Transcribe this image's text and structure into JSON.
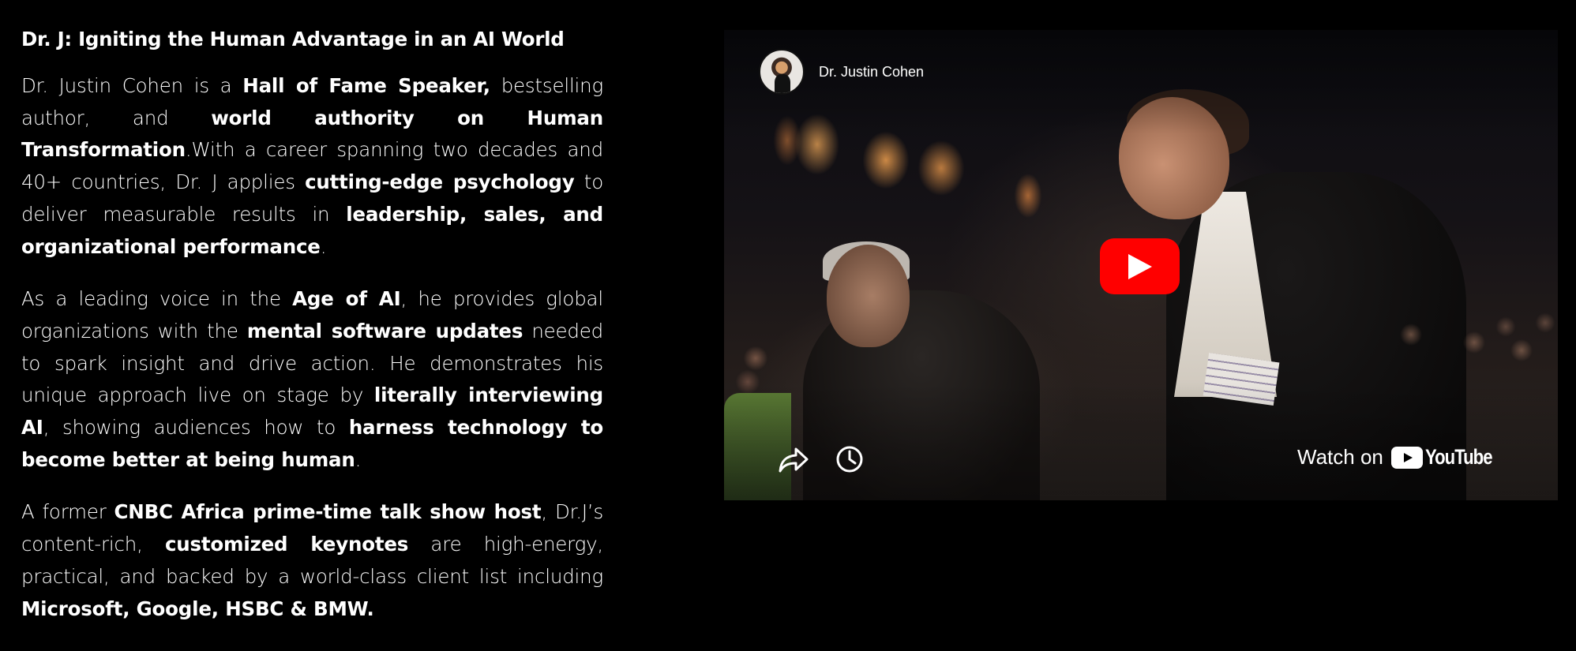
{
  "heading": "Dr. J: Igniting the Human Advantage in an AI World",
  "paragraph1": {
    "p1": "Dr. Justin Cohen is a ",
    "b1": "Hall of Fame Speaker,",
    "p2": " bestselling author, and ",
    "b2": "world authority on Human Transformation",
    "p3": ".With a career spanning two decades and 40+ countries, Dr. J applies ",
    "b3": "cutting-edge psychology",
    "p4": " to deliver measurable results in ",
    "b4": "leadership, sales, and organizational performance",
    "p5": "."
  },
  "paragraph2": {
    "p1": "As a leading voice in the ",
    "b1": "Age of AI",
    "p2": ", he provides global organizations with the ",
    "b2": "mental software updates",
    "p3": " needed to spark insight and drive action. He demonstrates his unique approach live on stage by ",
    "b3": "literally interviewing AI",
    "p4": ", showing audiences how to ",
    "b4": "harness technology to become better at being human",
    "p5": "."
  },
  "paragraph3": {
    "p1": "A former ",
    "b1": "CNBC Africa prime-time talk show host",
    "p2": ", Dr.J’s content-rich, ",
    "b2": "customized keynotes",
    "p3": " are high-energy, practical, and backed by a world-class client list including ",
    "b3": "Microsoft, Google, HSBC & BMW."
  },
  "video": {
    "channel_name": "Dr. Justin Cohen",
    "watch_on_label": "Watch on",
    "youtube_label": "YouTube",
    "play_icon": "play-icon",
    "share_icon": "share-icon",
    "watch_later_icon": "clock-icon",
    "play_button_color": "#ff0000"
  }
}
